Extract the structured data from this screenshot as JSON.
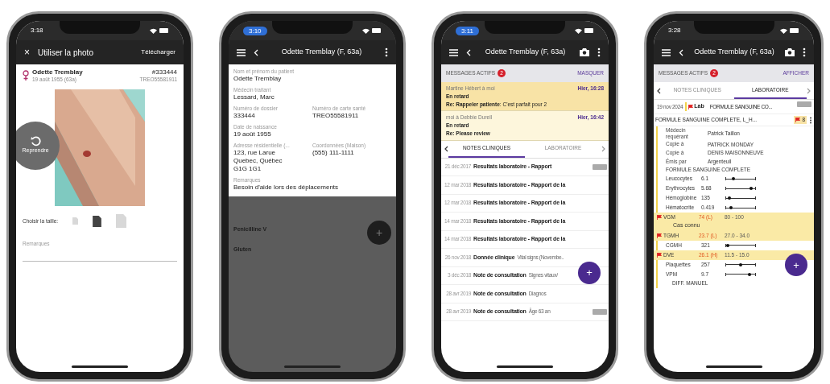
{
  "photo_screen": {
    "status_time": "3:18",
    "time_highlighted": false,
    "close": "×",
    "title": "Utiliser la photo",
    "action": "Télécharger",
    "patient": {
      "name": "Odette Tremblay",
      "birth": "19 août 1955 (63a)",
      "file_number": "#333444",
      "card_number": "TREO55581911"
    },
    "retake": "Reprendre",
    "size_label": "Choisir la taille:",
    "sizes": [
      {
        "selected": false
      },
      {
        "selected": true
      },
      {
        "selected": false
      }
    ],
    "remarks": {
      "placeholder": "Remarques"
    }
  },
  "patient_screen": {
    "status_time": "3:10",
    "time_highlighted": true,
    "title": "Odette Tremblay (F, 63a)",
    "field_rows": [
      [
        {
          "label": "Nom et prénom du patient",
          "value": "Odette Tremblay"
        }
      ],
      [
        {
          "label": "Médecin traitant",
          "value": "Lessard, Marc"
        }
      ],
      [
        {
          "label": "Numéro de dossier",
          "value": "333444"
        },
        {
          "label": "Numéro de carte santé",
          "value": "TREO55581911"
        }
      ],
      [
        {
          "label": "Date de naissance",
          "value": "19 août 1955"
        }
      ],
      [
        {
          "label": "Adresse résidentielle (...",
          "value": "123, rue Larue\nQuebec, Québec\nG1G 1G1"
        },
        {
          "label": "Coordonnées (Maison)",
          "value": "(555) 111-1111"
        }
      ],
      [
        {
          "label": "Remarques",
          "value": "Besoin d'aide lors des déplacements"
        }
      ]
    ],
    "dimmed_items": [
      "Penicilline V",
      "Gluten"
    ],
    "fab": "+"
  },
  "notes_screen": {
    "status_time": "3:11",
    "time_highlighted": true,
    "title": "Odette Tremblay (F, 63a)",
    "messages_header": {
      "label": "MESSAGES ACTIFS",
      "count": "2",
      "action": "MASQUER"
    },
    "messages": [
      {
        "from": "Martine Hébert à moi",
        "time": "Hier, 16:28",
        "status": "En retard",
        "subject": "Re: Rappeler patiente",
        "preview": ": C'est parfait pour 2",
        "highlighted": true
      },
      {
        "from": "moi à Debbie Durell",
        "time": "Hier, 16:42",
        "status": "En retard",
        "subject": "Re: Please review",
        "highlighted": false
      }
    ],
    "tabs": [
      {
        "label": "NOTES CLINIQUES",
        "selected": true
      },
      {
        "label": "LABORATOIRE",
        "selected": false
      }
    ],
    "notes": [
      {
        "date": "21 déc 2017",
        "title": "Resultats laboratoire - Rapport",
        "tagged": true
      },
      {
        "date": "12 mar 2018",
        "title": "Resultats laboratoire - Rapport de la",
        "tagged": false
      },
      {
        "date": "12 mar 2018",
        "title": "Resultats laboratoire - Rapport de la",
        "tagged": false
      },
      {
        "date": "14 mar 2018",
        "title": "Resultats laboratoire - Rapport de la",
        "tagged": false
      },
      {
        "date": "14 mar 2018",
        "title": "Resultats laboratoire - Rapport de la",
        "tagged": false
      },
      {
        "date": "26 nov 2018",
        "title": "Donnée clinique",
        "detail": "Vital signs (Novembe..",
        "tagged": false
      },
      {
        "date": "3 déc 2018",
        "title": "Note de consultation",
        "detail": "Signes vitaux/",
        "tagged": false
      },
      {
        "date": "28 avr 2019",
        "title": "Note de consultation",
        "detail": "Diagnos",
        "tagged": false
      },
      {
        "date": "28 avr 2019",
        "title": "Note de consultation",
        "detail": "Âge 63 an",
        "tagged": true
      }
    ],
    "fab": "+"
  },
  "lab_screen": {
    "status_time": "3:28",
    "time_highlighted": false,
    "title": "Odette Tremblay (F, 63a)",
    "messages_header": {
      "label": "MESSAGES ACTIFS",
      "count": "2",
      "action": "AFFICHER"
    },
    "tabs": [
      {
        "label": "NOTES CLINIQUES",
        "selected": false
      },
      {
        "label": "LABORATOIRE",
        "selected": true
      }
    ],
    "lab_entry": {
      "date": "19 nov 2024",
      "type": "Lab",
      "title": "FORMULE SANGUINE CO...",
      "tagged": true
    },
    "report": {
      "title": "FORMULE SANGUINE COMPLETE, L_H...",
      "flag_count": "8",
      "meta": [
        {
          "label": "Médecin requérant",
          "value": "Patrick Taillon"
        },
        {
          "label": "Copie à",
          "value": "PATRICK MONDAY"
        },
        {
          "label": "Copie à",
          "value": "DENIS MAISONNEUVE"
        },
        {
          "label": "Émis par",
          "value": "Argenteuil"
        }
      ],
      "section": "FORMULE SANGUINE COMPLETE",
      "results": [
        {
          "kind": "range",
          "name": "Leucocytes",
          "value": "6.1",
          "level": 0.25
        },
        {
          "kind": "range",
          "name": "Erythrocytes",
          "value": "5.68",
          "level": 0.85
        },
        {
          "kind": "range",
          "name": "Hémoglobine",
          "value": "135",
          "level": 0.1
        },
        {
          "kind": "range",
          "name": "Hématocrite",
          "value": "0.419",
          "level": 0.18
        },
        {
          "kind": "flagged",
          "name": "VGM",
          "value": "74 (L)",
          "reference": "80 - 100",
          "note": "Cas connu"
        },
        {
          "kind": "flagged",
          "name": "TGMH",
          "value": "23.7 (L)",
          "reference": "27.0 - 34.0"
        },
        {
          "kind": "range",
          "name": "CGMH",
          "value": "321",
          "level": 0.05
        },
        {
          "kind": "flagged",
          "name": "DVE",
          "value": "26.1 (H)",
          "reference": "11.5 - 15.0"
        },
        {
          "kind": "range",
          "name": "Plaquettes",
          "value": "257",
          "level": 0.5
        },
        {
          "kind": "range",
          "name": "VPM",
          "value": "9.7",
          "level": 0.8
        }
      ],
      "footer": "DIFF. MANUEL"
    },
    "fab": "+"
  }
}
